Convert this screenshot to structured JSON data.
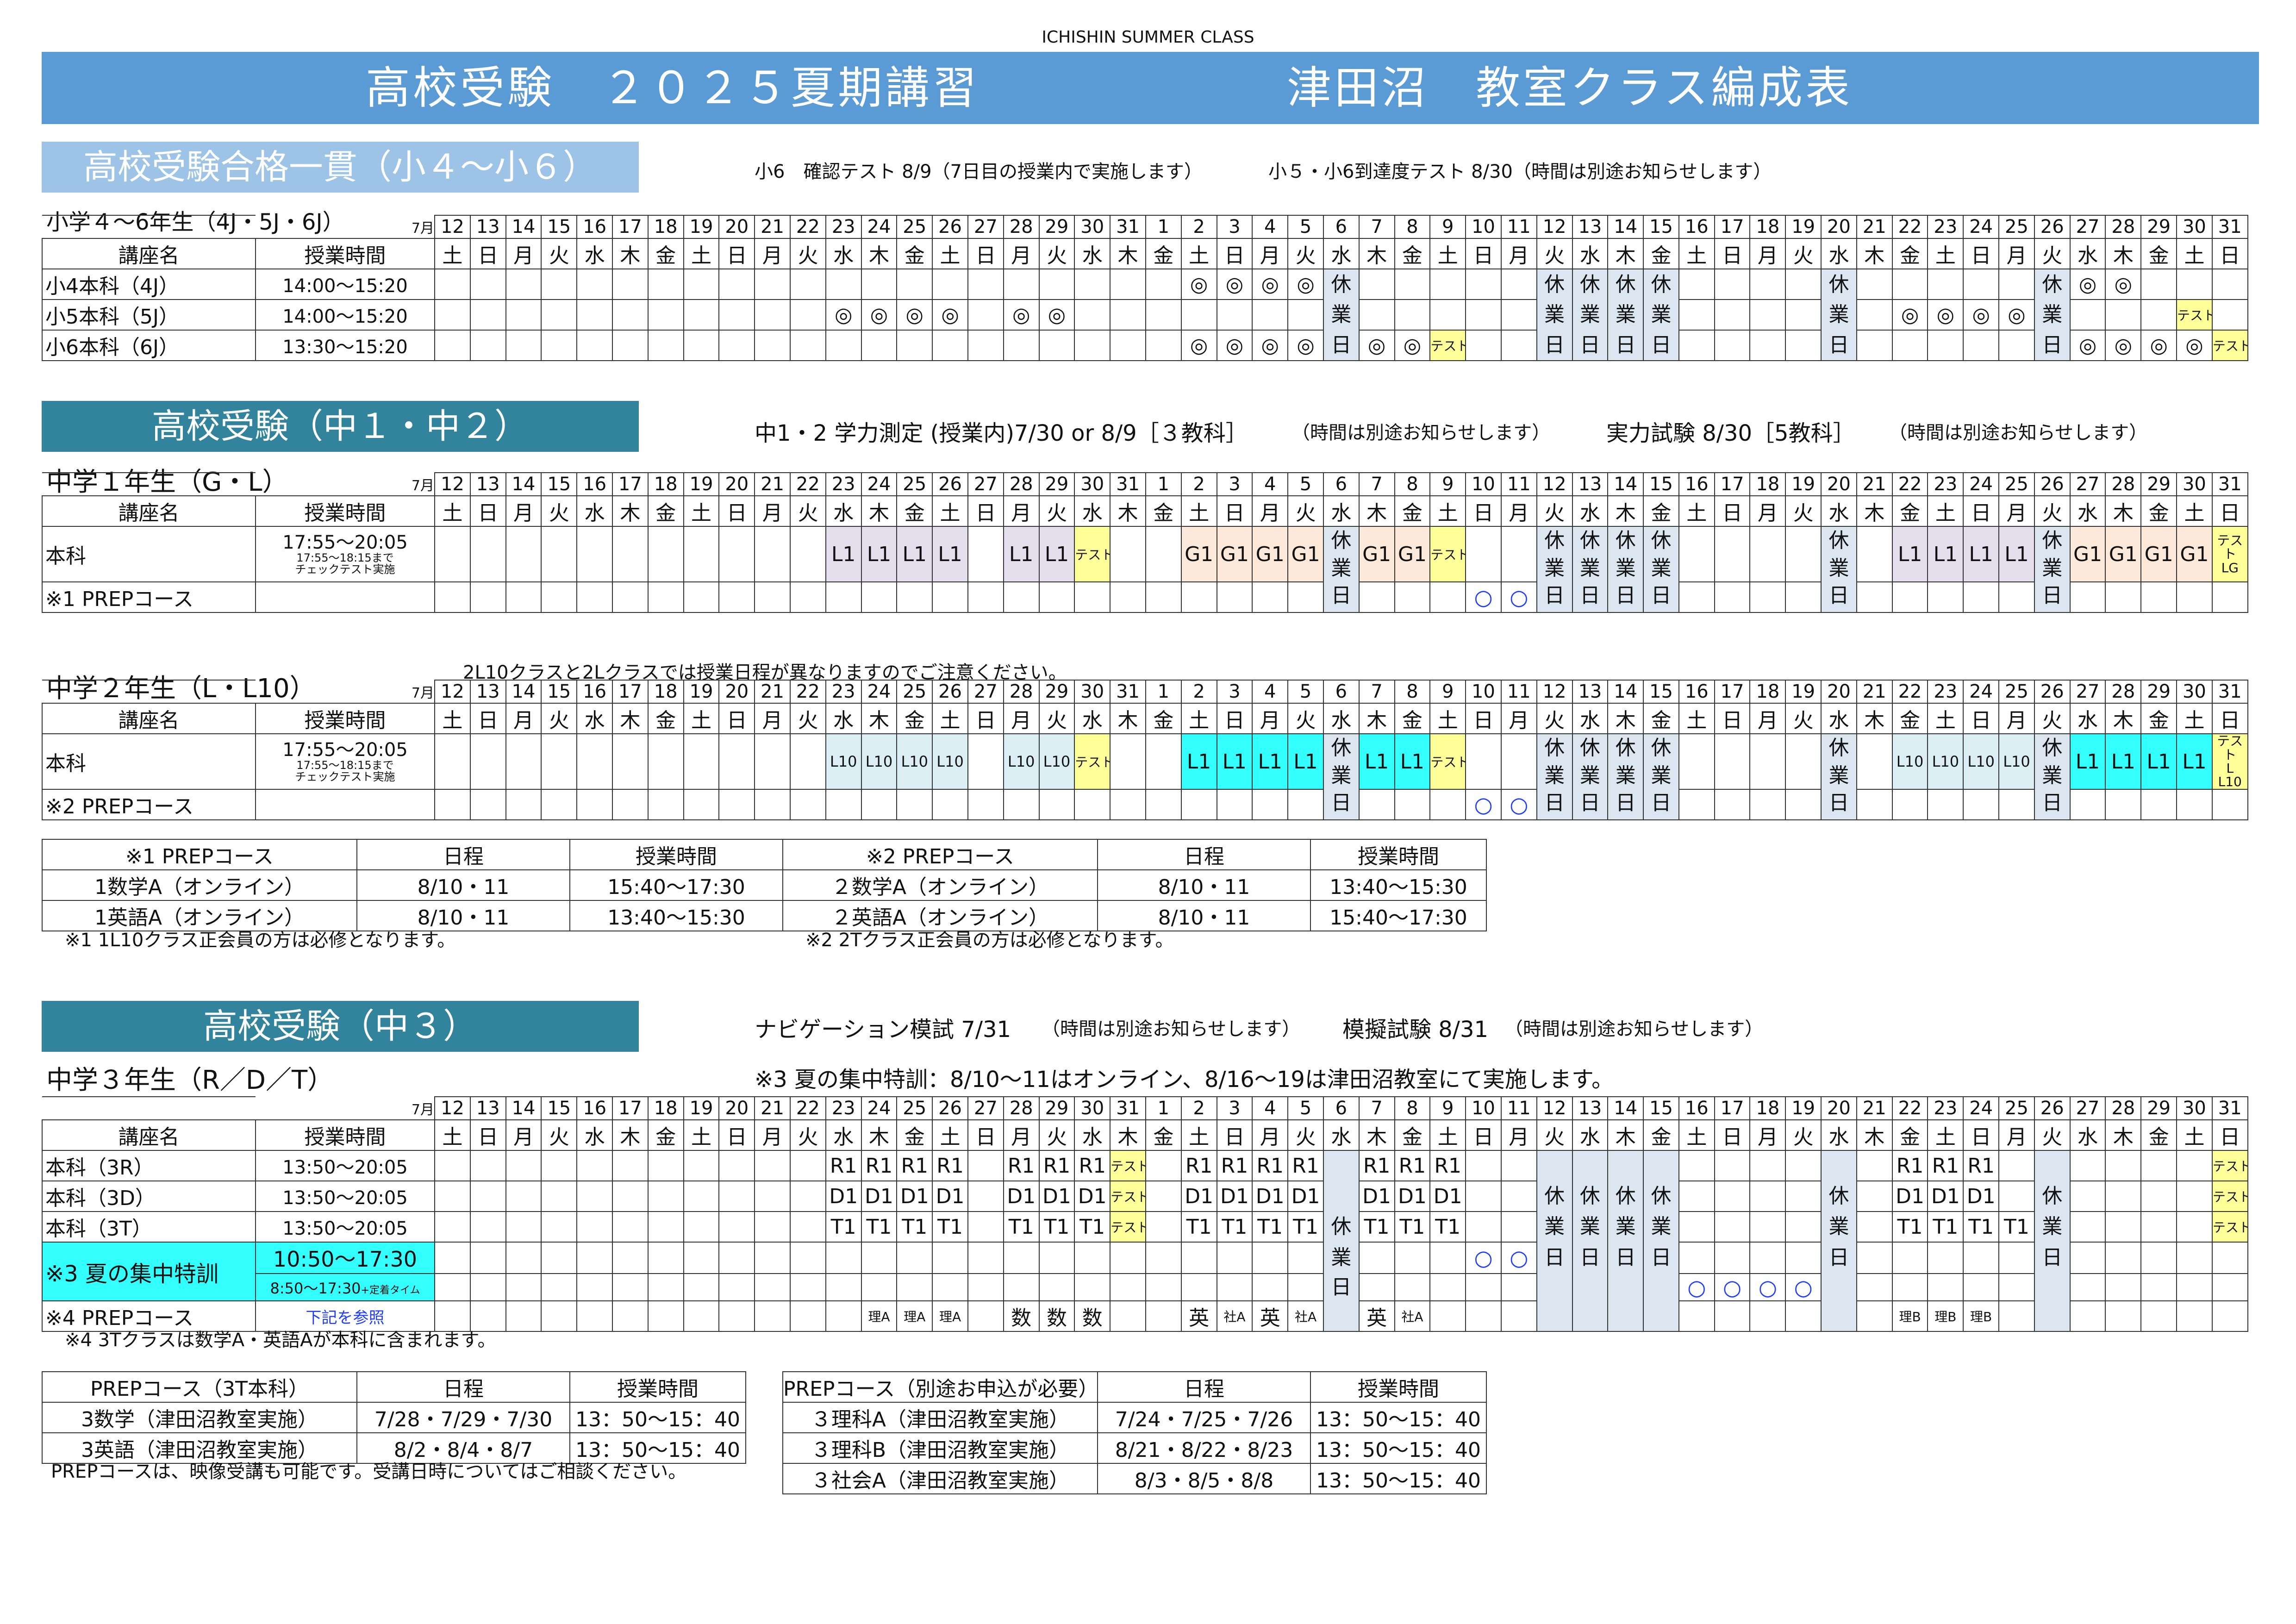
{
  "header": {
    "top": "ICHISHIN SUMMER CLASS",
    "title_left": "高校受験　２０２５夏期講習",
    "title_right": "津田沼　教室クラス編成表"
  },
  "colors": {
    "title_bar": "#5b9bd5",
    "elem_bar": "#9dc3e6",
    "middle_bar": "#31849b",
    "holiday": "#dce6f1",
    "lavender": "#e4dfec",
    "peach": "#fde9d9",
    "test_yellow": "#ffff99",
    "cyan": "#33ffff",
    "light_blue": "#dbeef4",
    "circle": "#1f3cff"
  },
  "calendar": {
    "month_label": "7月",
    "days": [
      "12",
      "13",
      "14",
      "15",
      "16",
      "17",
      "18",
      "19",
      "20",
      "21",
      "22",
      "23",
      "24",
      "25",
      "26",
      "27",
      "28",
      "29",
      "30",
      "31",
      "1",
      "2",
      "3",
      "4",
      "5",
      "6",
      "7",
      "8",
      "9",
      "10",
      "11",
      "12",
      "13",
      "14",
      "15",
      "16",
      "17",
      "18",
      "19",
      "20",
      "21",
      "22",
      "23",
      "24",
      "25",
      "26",
      "27",
      "28",
      "29",
      "30",
      "31"
    ],
    "weekdays": [
      "土",
      "日",
      "月",
      "火",
      "水",
      "木",
      "金",
      "土",
      "日",
      "月",
      "火",
      "水",
      "木",
      "金",
      "土",
      "日",
      "月",
      "火",
      "水",
      "木",
      "金",
      "土",
      "日",
      "月",
      "火",
      "水",
      "木",
      "金",
      "土",
      "日",
      "月",
      "火",
      "水",
      "木",
      "金",
      "土",
      "日",
      "月",
      "火",
      "水",
      "木",
      "金",
      "土",
      "日",
      "月",
      "火",
      "水",
      "木",
      "金",
      "土",
      "日"
    ],
    "col_name": "講座名",
    "col_time": "授業時間",
    "holiday_text": "休業日"
  },
  "elem": {
    "banner": "高校受験合格一貫（小４～小６）",
    "note1": "小6　確認テスト 8/9（7日目の授業内で実施します）",
    "note2": "小５・小6到達度テスト 8/30（時間は別途お知らせします）",
    "grade_label": "小学４～6年生（4J・5J・6J）",
    "rows": [
      {
        "name": "小4本科（4J）",
        "time": "14:00～15:20",
        "cells": {
          "21": "◎",
          "22": "◎",
          "23": "◎",
          "24": "◎",
          "46": "◎",
          "47": "◎"
        }
      },
      {
        "name": "小5本科（5J）",
        "time": "14:00～15:20",
        "cells": {
          "11": "◎",
          "12": "◎",
          "13": "◎",
          "14": "◎",
          "16": "◎",
          "17": "◎",
          "41": "◎",
          "42": "◎",
          "43": "◎",
          "44": "◎",
          "49": "テスト"
        }
      },
      {
        "name": "小6本科（6J）",
        "time": "13:30～15:20",
        "cells": {
          "21": "◎",
          "22": "◎",
          "23": "◎",
          "24": "◎",
          "26": "◎",
          "27": "◎",
          "28": "テスト",
          "46": "◎",
          "47": "◎",
          "48": "◎",
          "49": "◎",
          "50": "テスト"
        }
      }
    ]
  },
  "m1": {
    "banner": "高校受験（中１・中２）",
    "note1": "中1・2 学力測定 (授業内)7/30 or 8/9［３教科］",
    "note1b": "（時間は別途お知らせします）",
    "note2": "実力試験 8/30［5教科］",
    "note2b": "（時間は別途お知らせします）",
    "grade_label": "中学１年生（G・L）",
    "main_name": "本科",
    "main_time": "17:55～20:05",
    "main_time_sub1": "17:55～18:15まで",
    "main_time_sub2": "チェックテスト実施",
    "prep_name": "※1 PREPコース",
    "cells": {
      "11": "L1",
      "12": "L1",
      "13": "L1",
      "14": "L1",
      "16": "L1",
      "17": "L1",
      "18": "テスト",
      "21": "G1",
      "22": "G1",
      "23": "G1",
      "24": "G1",
      "26": "G1",
      "27": "G1",
      "28": "テスト",
      "41": "L1",
      "42": "L1",
      "43": "L1",
      "44": "L1",
      "46": "G1",
      "47": "G1",
      "48": "G1",
      "49": "G1",
      "50": "テスト LG"
    },
    "prep_cells": {
      "29": "○",
      "30": "○"
    }
  },
  "m2": {
    "note": "2L10クラスと2Lクラスでは授業日程が異なりますのでご注意ください。",
    "grade_label": "中学２年生（L・L10）",
    "main_name": "本科",
    "main_time": "17:55～20:05",
    "main_time_sub1": "17:55～18:15まで",
    "main_time_sub2": "チェックテスト実施",
    "prep_name": "※2 PREPコース",
    "cells": {
      "11": "L10",
      "12": "L10",
      "13": "L10",
      "14": "L10",
      "16": "L10",
      "17": "L10",
      "18": "テスト",
      "21": "L1",
      "22": "L1",
      "23": "L1",
      "24": "L1",
      "26": "L1",
      "27": "L1",
      "28": "テスト",
      "41": "L10",
      "42": "L10",
      "43": "L10",
      "44": "L10",
      "46": "L1",
      "47": "L1",
      "48": "L1",
      "49": "L1",
      "50": "テスト L L10"
    },
    "prep_cells": {
      "29": "○",
      "30": "○"
    }
  },
  "prep1": {
    "headers": [
      "※1 PREPコース",
      "日程",
      "授業時間"
    ],
    "rows": [
      [
        "1数学A（オンライン）",
        "8/10・11",
        "15:40～17:30"
      ],
      [
        "1英語A（オンライン）",
        "8/10・11",
        "13:40～15:30"
      ]
    ],
    "note": "※1 1L10クラス正会員の方は必修となります。"
  },
  "prep2": {
    "headers": [
      "※2 PREPコース",
      "日程",
      "授業時間"
    ],
    "rows": [
      [
        "２数学A（オンライン）",
        "8/10・11",
        "13:40～15:30"
      ],
      [
        "２英語A（オンライン）",
        "8/10・11",
        "15:40～17:30"
      ]
    ],
    "note": "※2 2Tクラス正会員の方は必修となります。"
  },
  "m3": {
    "banner": "高校受験（中３）",
    "note1": "ナビゲーション模試 7/31",
    "note1b": "（時間は別途お知らせします）",
    "note2": "模擬試験 8/31",
    "note2b": "（時間は別途お知らせします）",
    "note3": "※3 夏の集中特訓：8/10～11はオンライン、8/16～19は津田沼教室にて実施します。",
    "grade_label": "中学３年生（R／D／T）",
    "rows": [
      {
        "name": "本科（3R）",
        "time": "13:50～20:05",
        "cells": {
          "11": "R1",
          "12": "R1",
          "13": "R1",
          "14": "R1",
          "16": "R1",
          "17": "R1",
          "18": "R1",
          "19": "テスト",
          "21": "R1",
          "22": "R1",
          "23": "R1",
          "24": "R1",
          "26": "R1",
          "27": "R1",
          "28": "R1",
          "41": "R1",
          "42": "R1",
          "43": "R1",
          "50": "テスト"
        }
      },
      {
        "name": "本科（3D）",
        "time": "13:50～20:05",
        "cells": {
          "11": "D1",
          "12": "D1",
          "13": "D1",
          "14": "D1",
          "16": "D1",
          "17": "D1",
          "18": "D1",
          "19": "テスト",
          "21": "D1",
          "22": "D1",
          "23": "D1",
          "24": "D1",
          "26": "D1",
          "27": "D1",
          "28": "D1",
          "41": "D1",
          "42": "D1",
          "43": "D1",
          "50": "テスト"
        }
      },
      {
        "name": "本科（3T）",
        "time": "13:50～20:05",
        "cells": {
          "11": "T1",
          "12": "T1",
          "13": "T1",
          "14": "T1",
          "16": "T1",
          "17": "T1",
          "18": "T1",
          "19": "テスト",
          "21": "T1",
          "22": "T1",
          "23": "T1",
          "24": "T1",
          "26": "T1",
          "27": "T1",
          "28": "T1",
          "41": "T1",
          "42": "T1",
          "43": "T1",
          "44": "T1",
          "50": "テスト"
        }
      }
    ],
    "special_name": "※3 夏の集中特訓",
    "special_time1": "10:50～17:30",
    "special_time2": "8:50～17:30",
    "special_time2b": "+定着タイム",
    "special_cells": {
      "29": "○",
      "30": "○",
      "35": "○",
      "36": "○",
      "37": "○",
      "38": "○"
    },
    "prep_name": "※4 PREPコース",
    "prep_time": "下記を参照",
    "prep_cells": {
      "12": "理A",
      "13": "理A",
      "14": "理A",
      "16": "数",
      "17": "数",
      "18": "数",
      "21": "英",
      "22": "社A",
      "23": "英",
      "24": "社A",
      "26": "英",
      "27": "社A",
      "41": "理B",
      "42": "理B",
      "43": "理B"
    },
    "note4": "※4 3Tクラスは数学A・英語Aが本科に含まれます。"
  },
  "prep3": {
    "headers": [
      "PREPコース（3T本科）",
      "日程",
      "授業時間"
    ],
    "rows": [
      [
        "3数学（津田沼教室実施）",
        "7/28・7/29・7/30",
        "13：50～15：40"
      ],
      [
        "3英語（津田沼教室実施）",
        "8/2・8/4・8/7",
        "13：50～15：40"
      ]
    ],
    "note": "PREPコースは、映像受講も可能です。受講日時についてはご相談ください。"
  },
  "prep4": {
    "headers": [
      "PREPコース（別途お申込が必要）",
      "日程",
      "授業時間"
    ],
    "rows": [
      [
        "３理科A（津田沼教室実施）",
        "7/24・7/25・7/26",
        "13：50～15：40"
      ],
      [
        "３理科B（津田沼教室実施）",
        "8/21・8/22・8/23",
        "13：50～15：40"
      ],
      [
        "３社会A（津田沼教室実施）",
        "8/3・8/5・8/8",
        "13：50～15：40"
      ]
    ]
  }
}
